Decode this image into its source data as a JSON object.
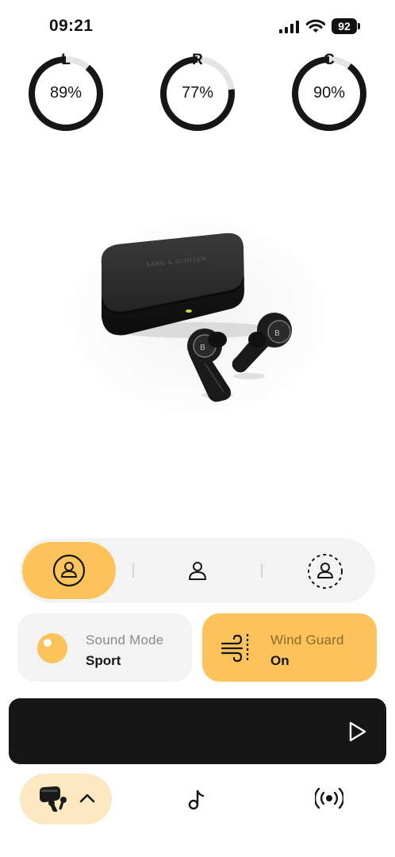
{
  "status_bar": {
    "time": "09:21",
    "battery_level": "92",
    "icons": [
      "cellular-signal-icon",
      "wifi-icon",
      "battery-icon"
    ]
  },
  "batteries": [
    {
      "label": "L",
      "value_text": "89%",
      "level": 0.89
    },
    {
      "label": "R",
      "value_text": "77%",
      "level": 0.77
    },
    {
      "label": "C",
      "value_text": "90%",
      "level": 0.9
    }
  ],
  "product": {
    "image": "earbuds-with-charging-case",
    "engraving": "BANG & OLUFSEN"
  },
  "profiles": {
    "items": [
      "profile-1-icon",
      "profile-2-icon",
      "add-profile-icon"
    ],
    "selected_index": 0
  },
  "sound_mode": {
    "title": "Sound Mode",
    "value": "Sport"
  },
  "wind_guard": {
    "title": "Wind Guard",
    "value": "On"
  },
  "player": {
    "icon": "play-icon"
  },
  "tabs": {
    "items": [
      "device-tab",
      "music-tab",
      "broadcast-tab"
    ],
    "selected_index": 0
  },
  "colors": {
    "accent": "#fbc35a",
    "accent_light": "#fde9c1",
    "dark": "#161616",
    "surface": "#f3f3f3",
    "ring_track": "#e4e4e4"
  }
}
